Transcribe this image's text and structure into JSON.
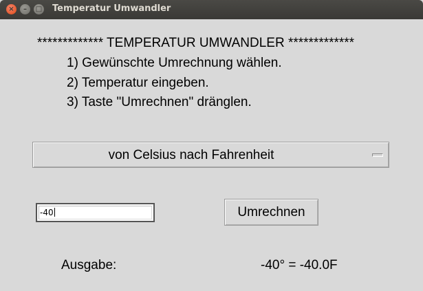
{
  "window": {
    "title": "Temperatur Umwandler",
    "close_glyph": "×",
    "minimize_glyph": "–",
    "maximize_glyph": "□"
  },
  "content": {
    "heading": "************* TEMPERATUR UMWANDLER *************",
    "steps": [
      "1) Gewünschte Umrechnung wählen.",
      "2) Temperatur eingeben.",
      "3) Taste \"Umrechnen\" dränglen."
    ],
    "conversion_select": {
      "selected": "von Celsius nach Fahrenheit"
    },
    "temperature_input": {
      "value": "-40"
    },
    "convert_button": "Umrechnen",
    "output": {
      "label": "Ausgabe:",
      "value": "-40° = -40.0F"
    }
  },
  "colors": {
    "window_bg": "#d9d9d9",
    "titlebar": "#3c3b37",
    "close_button": "#e9541f"
  }
}
